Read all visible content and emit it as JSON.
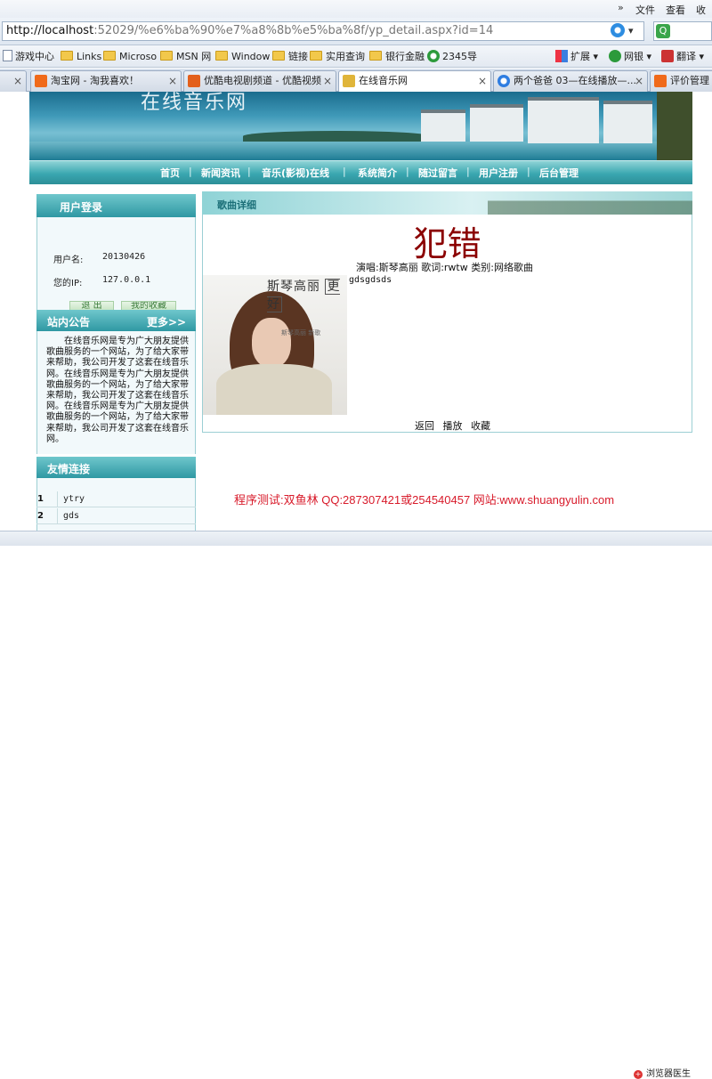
{
  "browser": {
    "menu": {
      "file": "文件",
      "view": "查看",
      "favorites": "收藏"
    },
    "address": {
      "host": "http://localhost",
      "rest": ":52029/%e6%ba%90%e7%a8%8b%e5%ba%8f/yp_detail.aspx?id=14"
    },
    "favorites": [
      {
        "label": "游戏中心"
      },
      {
        "label": "Links"
      },
      {
        "label": "Microso"
      },
      {
        "label": "MSN 网"
      },
      {
        "label": "Window"
      },
      {
        "label": "链接"
      },
      {
        "label": "实用查询"
      },
      {
        "label": "银行金融"
      },
      {
        "label": "2345导"
      }
    ],
    "toolbar": {
      "extend": "扩展",
      "netbank": "网银",
      "translate": "翻译"
    },
    "tabs": [
      {
        "label": "淘宝网 - 淘我喜欢！"
      },
      {
        "label": "优酷电视剧频道 - 优酷视频"
      },
      {
        "label": "在线音乐网"
      },
      {
        "label": "两个爸爸 03—在线播放—..."
      },
      {
        "label": "评价管理"
      }
    ],
    "status": {
      "doctor": "浏览器医生"
    }
  },
  "site": {
    "banner_title": "在线音乐网",
    "nav": [
      "首页",
      "新闻资讯",
      "音乐(影视)在线",
      "系统简介",
      "随过留言",
      "用户注册",
      "后台管理"
    ],
    "login": {
      "title": "用户登录",
      "username_label": "用户名:",
      "username": "20130426",
      "ip_label": "您的IP:",
      "ip": "127.0.0.1",
      "logout": "退 出",
      "favorites": "我的收藏"
    },
    "notice": {
      "title": "站内公告",
      "more": "更多>>",
      "text": "在线音乐网是专为广大朋友提供歌曲服务的一个网站，为了给大家带来帮助，我公司开发了这套在线音乐网。在线音乐网是专为广大朋友提供歌曲服务的一个网站，为了给大家带来帮助，我公司开发了这套在线音乐网。在线音乐网是专为广大朋友提供歌曲服务的一个网站，为了给大家带来帮助，我公司开发了这套在线音乐网。"
    },
    "links": {
      "title": "友情连接",
      "items": [
        {
          "num": "1",
          "text": "ytry"
        },
        {
          "num": "2",
          "text": "gds"
        }
      ]
    },
    "detail": {
      "header": "歌曲详细",
      "title": "犯错",
      "meta": "演唱:斯琴高丽 歌词:rwtw 类别:网络歌曲",
      "lyric": "gdsgdsds",
      "cover_brand": "斯琴高丽",
      "cover_tag": "更好",
      "cover_sub": "斯琴高丽 新歌",
      "actions": [
        "返回",
        "播放",
        "收藏"
      ]
    },
    "footer": "程序测试:双鱼林 QQ:287307421或254540457 网站:www.shuangyulin.com"
  },
  "colors": {
    "accent_teal": "#3aa7b0",
    "title_red": "#8b0000",
    "credit_red": "#d81a2a"
  }
}
